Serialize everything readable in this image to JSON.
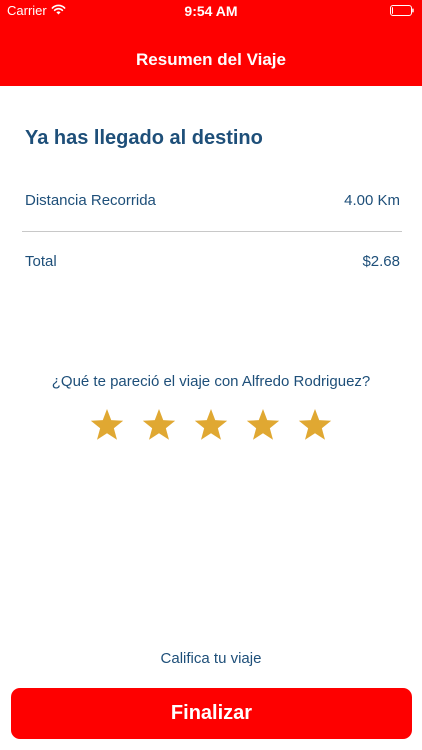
{
  "status_bar": {
    "carrier": "Carrier",
    "time": "9:54 AM",
    "battery_level": 0.05
  },
  "header": {
    "title": "Resumen del Viaje"
  },
  "summary": {
    "heading": "Ya has llegado al destino",
    "distance_label": "Distancia Recorrida",
    "distance_value": "4.00 Km",
    "total_label": "Total",
    "total_value": "$2.68"
  },
  "rating": {
    "question": "¿Qué te pareció el viaje con Alfredo Rodriguez?",
    "stars_filled": 5,
    "stars_total": 5,
    "star_color": "#e0a832",
    "prompt": "Califica tu viaje"
  },
  "actions": {
    "finish_label": "Finalizar"
  },
  "colors": {
    "accent": "#fe0000",
    "text": "#1e4f79"
  }
}
